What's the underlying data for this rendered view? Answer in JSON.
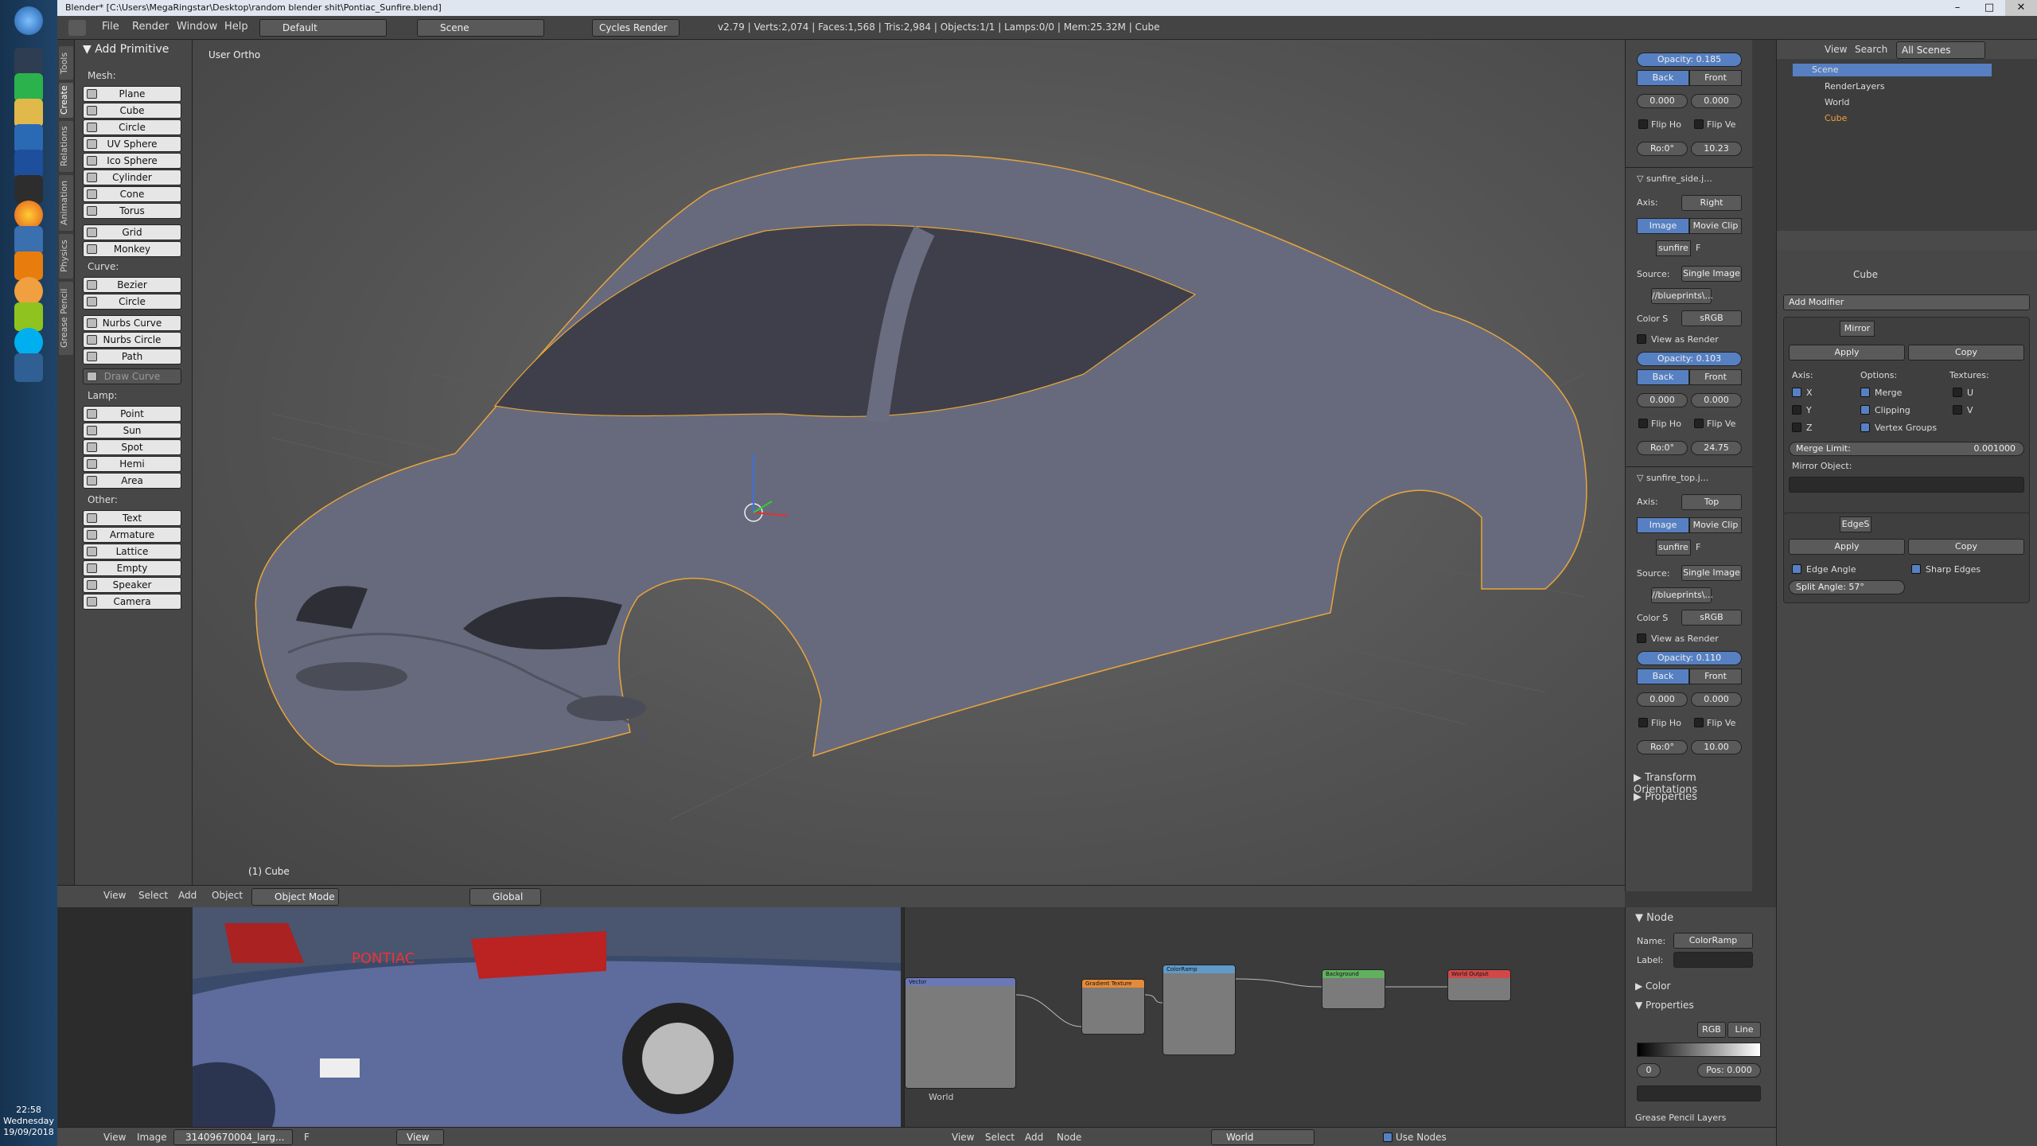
{
  "window": {
    "title": "Blender* [C:\\Users\\MegaRingstar\\Desktop\\random blender shit\\Pontiac_Sunfire.blend]",
    "min": "–",
    "max": "□",
    "close": "✕"
  },
  "taskbar": {
    "time": "22:58",
    "day": "Wednesday",
    "date": "19/09/2018"
  },
  "menubar": {
    "items": [
      "File",
      "Render",
      "Window",
      "Help"
    ],
    "layout": "Default",
    "scene": "Scene",
    "engine": "Cycles Render",
    "stats": "v2.79 | Verts:2,074 | Faces:1,568 | Tris:2,984 | Objects:1/1 | Lamps:0/0 | Mem:25.32M | Cube"
  },
  "tool_tabs": [
    "Tools",
    "Create",
    "Relations",
    "Animation",
    "Physics",
    "Grease Pencil"
  ],
  "toolpanel": {
    "header": "Add Primitive",
    "mesh_label": "Mesh:",
    "mesh": [
      "Plane",
      "Cube",
      "Circle",
      "UV Sphere",
      "Ico Sphere",
      "Cylinder",
      "Cone",
      "Torus"
    ],
    "mesh2": [
      "Grid",
      "Monkey"
    ],
    "curve_label": "Curve:",
    "curve": [
      "Bezier",
      "Circle"
    ],
    "curve2": [
      "Nurbs Curve",
      "Nurbs Circle",
      "Path"
    ],
    "draw_curve": "Draw Curve",
    "lamp_label": "Lamp:",
    "lamp": [
      "Point",
      "Sun",
      "Spot",
      "Hemi",
      "Area"
    ],
    "other_label": "Other:",
    "other": [
      "Text",
      "Armature",
      "Lattice",
      "Empty",
      "Speaker",
      "Camera"
    ]
  },
  "viewport": {
    "view_label": "User Ortho",
    "object_label": "(1) Cube"
  },
  "bg_images": {
    "top": {
      "opacity_label": "Opacity:",
      "opacity": "0.185",
      "back": "Back",
      "front": "Front",
      "x": "0.000",
      "y": "0.000",
      "flip_h": "Flip Ho",
      "flip_v": "Flip Ve",
      "rot": "Ro:0°",
      "size": "10.23"
    },
    "side": {
      "name": "sunfire_side.j...",
      "axis_label": "Axis:",
      "axis": "Right",
      "image": "Image",
      "movie": "Movie Clip",
      "img_name": "sunfire",
      "f": "F",
      "source_label": "Source:",
      "source": "Single Image",
      "path": "//blueprints\\...",
      "color_label": "Color S",
      "color": "sRGB",
      "view_render": "View as Render",
      "opacity": "0.103",
      "x": "0.000",
      "y": "0.000",
      "rot": "Ro:0°",
      "size": "24.75"
    },
    "topimg": {
      "name": "sunfire_top.j...",
      "axis": "Top",
      "img_name": "sunfire",
      "source": "Single Image",
      "path": "//blueprints\\...",
      "color": "sRGB",
      "opacity": "0.110",
      "x": "0.000",
      "y": "0.000",
      "rot": "Ro:0°",
      "size": "10.00"
    },
    "transform_orient": "Transform Orientations",
    "properties": "Properties"
  },
  "outliner": {
    "menu": [
      "View",
      "Search"
    ],
    "scenes": "All Scenes",
    "items": [
      "Scene",
      "RenderLayers",
      "World",
      "Cube"
    ]
  },
  "properties": {
    "object": "Cube",
    "add_modifier": "Add Modifier",
    "mirror": {
      "name": "Mirror",
      "apply": "Apply",
      "copy": "Copy",
      "axis_label": "Axis:",
      "options_label": "Options:",
      "textures_label": "Textures:",
      "x": "X",
      "y": "Y",
      "z": "Z",
      "merge": "Merge",
      "clipping": "Clipping",
      "vertex_groups": "Vertex Groups",
      "u": "U",
      "v": "V",
      "merge_limit_label": "Merge Limit:",
      "merge_limit": "0.001000",
      "mirror_object": "Mirror Object:"
    },
    "edgesplit": {
      "name": "EdgeS",
      "apply": "Apply",
      "copy": "Copy",
      "edge_angle": "Edge Angle",
      "sharp_edges": "Sharp Edges",
      "split_angle_label": "Split Angle:",
      "split_angle": "57°"
    }
  },
  "vp_header": {
    "menu": [
      "View",
      "Select",
      "Add",
      "Object"
    ],
    "mode": "Object Mode",
    "orientation": "Global"
  },
  "node_props": {
    "header": "Node",
    "name_label": "Name:",
    "name": "ColorRamp",
    "label_label": "Label:",
    "color": "Color",
    "properties": "Properties",
    "mode": "RGB",
    "interp": "Line",
    "index": "0",
    "pos": "Pos:  0.000",
    "grease": "Grease Pencil Layers"
  },
  "nodes": {
    "mapping": "Vector",
    "gradient": "Gradient Texture",
    "colorramp": "ColorRamp",
    "background": "Background",
    "output": "World Output",
    "world_label": "World"
  },
  "image_header": {
    "menu": [
      "View",
      "Image"
    ],
    "image_name": "31409670004_larg...",
    "f": "F",
    "view": "View"
  },
  "node_header": {
    "menu": [
      "View",
      "Select",
      "Add",
      "Node"
    ],
    "world": "World",
    "use_nodes": "Use Nodes"
  },
  "photo": {
    "brand": "PONTIAC"
  }
}
